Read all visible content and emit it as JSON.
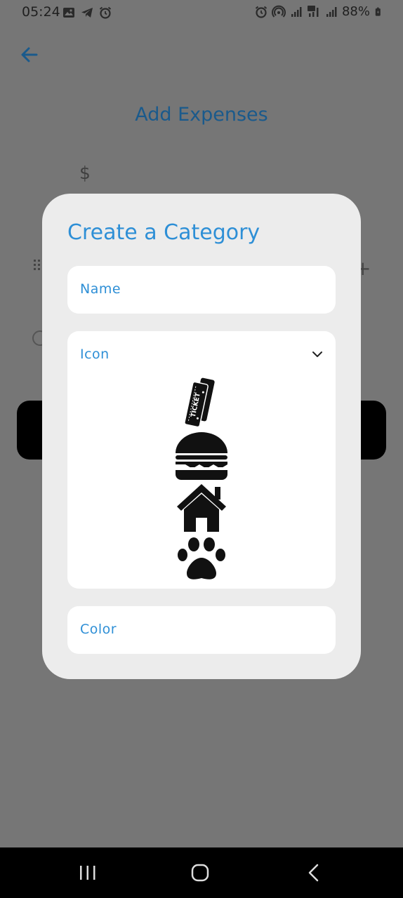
{
  "status": {
    "time": "05:24",
    "battery": "88%",
    "left_icons": [
      "image-icon",
      "telegram-icon",
      "alarm-icon"
    ],
    "right_icons": [
      "alarm-icon",
      "hotspot-icon",
      "signal-icon",
      "5g-signal-icon",
      "signal-icon",
      "battery-icon"
    ]
  },
  "page": {
    "title": "Add Expenses",
    "amount_prefix": "$"
  },
  "dialog": {
    "title": "Create a Category",
    "name_field": {
      "label": "Name",
      "value": ""
    },
    "icon_field": {
      "label": "Icon",
      "options": [
        "ticket-icon",
        "burger-icon",
        "home-icon",
        "paw-icon"
      ]
    },
    "color_field": {
      "label": "Color",
      "value": ""
    }
  },
  "colors": {
    "accent": "#2e8fd6",
    "page_title": "#1a5a8c",
    "scrim": "#767676",
    "dialog_bg": "#ececec"
  }
}
